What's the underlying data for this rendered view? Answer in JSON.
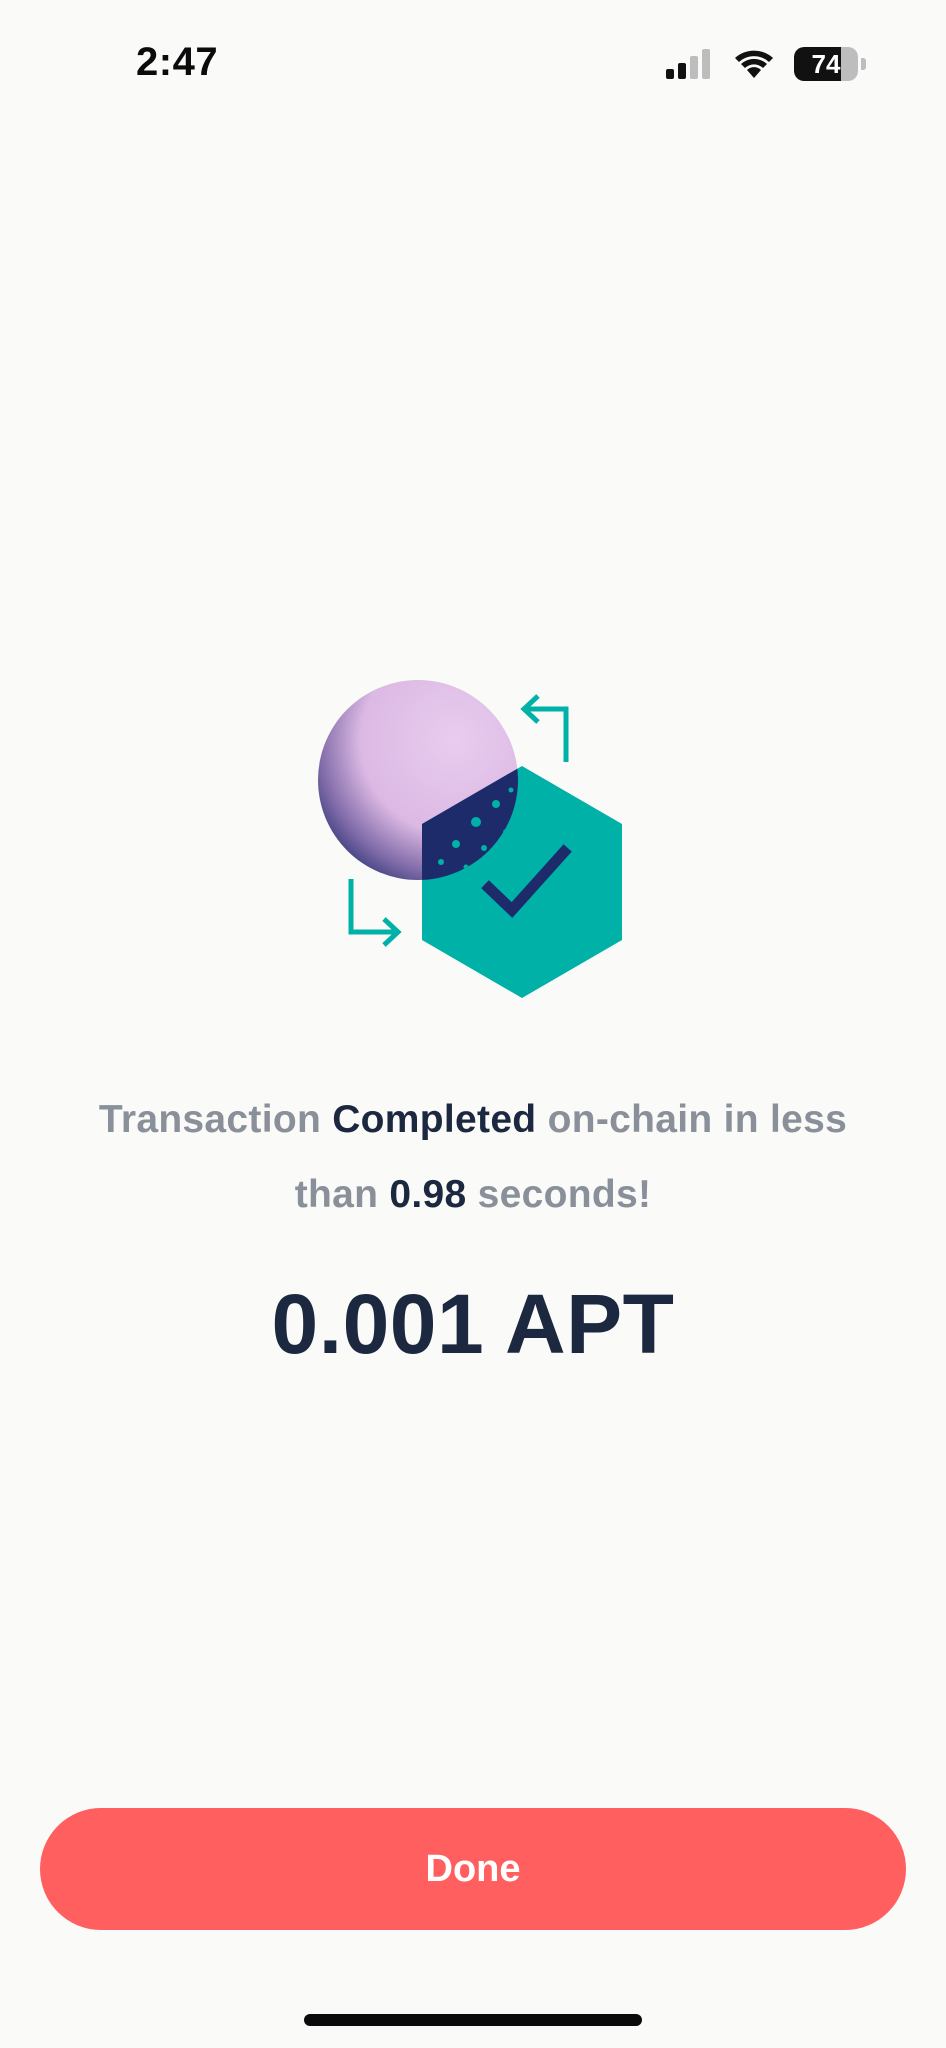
{
  "status_bar": {
    "time": "2:47",
    "battery_level": "74",
    "signal_bars_active": 2,
    "signal_bars_total": 4
  },
  "illustration": {
    "icon_name": "transaction-complete-illustration",
    "colors": {
      "circle": "#E6C9EC",
      "circle_shade": "#1D2B6B",
      "hexagon": "#00B1A8",
      "checkmark": "#1D2B6B",
      "arrows": "#00B1A8"
    }
  },
  "message": {
    "part1": "Transaction ",
    "highlight1": "Completed",
    "part2": " on-chain in less than ",
    "highlight2": "0.98",
    "part3": " seconds!"
  },
  "amount": "0.001 APT",
  "done_button": {
    "label": "Done",
    "color": "#FF5F5F"
  }
}
